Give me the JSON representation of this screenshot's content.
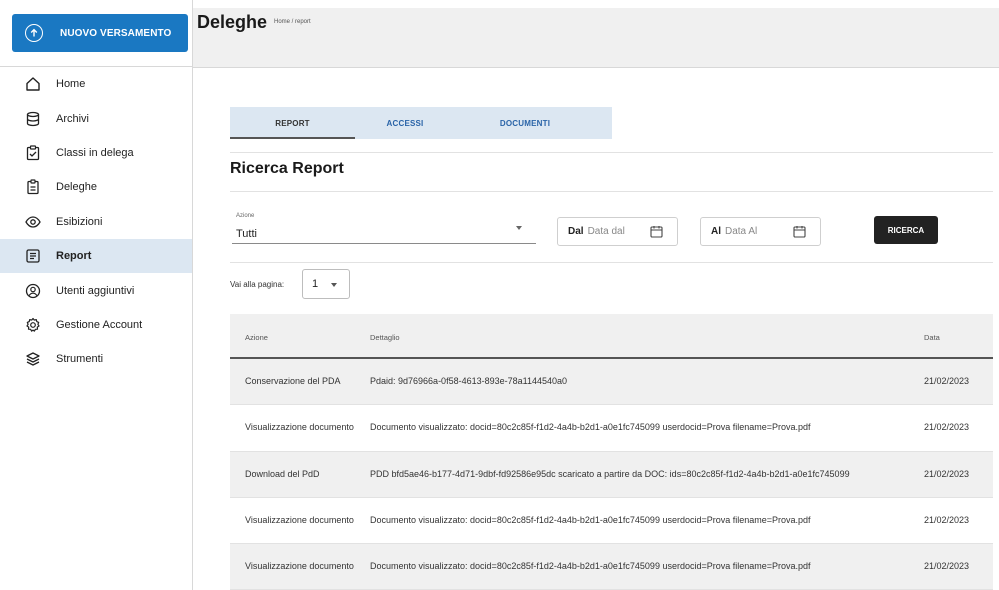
{
  "sidebar": {
    "new_button": "NUOVO VERSAMENTO",
    "items": [
      {
        "label": "Home",
        "icon": "home-icon"
      },
      {
        "label": "Archivi",
        "icon": "database-icon"
      },
      {
        "label": "Classi in delega",
        "icon": "clipboard-check-icon"
      },
      {
        "label": "Deleghe",
        "icon": "document-icon"
      },
      {
        "label": "Esibizioni",
        "icon": "eye-icon"
      },
      {
        "label": "Report",
        "icon": "report-icon",
        "active": true
      },
      {
        "label": "Utenti aggiuntivi",
        "icon": "user-icon"
      },
      {
        "label": "Gestione Account",
        "icon": "gear-icon"
      },
      {
        "label": "Strumenti",
        "icon": "layers-icon"
      }
    ]
  },
  "header": {
    "title": "Deleghe",
    "breadcrumb": "Home / report"
  },
  "tabs": [
    "REPORT",
    "ACCESSI",
    "DOCUMENTI"
  ],
  "section_title": "Ricerca Report",
  "filters": {
    "azione_label": "Azione",
    "azione_value": "Tutti",
    "dal_label": "Dal",
    "dal_placeholder": "Data dal",
    "al_label": "Al",
    "al_placeholder": "Data Al",
    "search_button": "RICERCA"
  },
  "pagination": {
    "label": "Vai alla pagina:",
    "value": "1"
  },
  "table": {
    "headers": [
      "Azione",
      "Dettaglio",
      "Data"
    ],
    "rows": [
      {
        "azione": "Conservazione del PDA",
        "dettaglio": "Pdaid: 9d76966a-0f58-4613-893e-78a1144540a0",
        "data": "21/02/2023"
      },
      {
        "azione": "Visualizzazione documento",
        "dettaglio": "Documento visualizzato: docid=80c2c85f-f1d2-4a4b-b2d1-a0e1fc745099 userdocid=Prova filename=Prova.pdf",
        "data": "21/02/2023"
      },
      {
        "azione": "Download del PdD",
        "dettaglio": "PDD bfd5ae46-b177-4d71-9dbf-fd92586e95dc scaricato a partire da DOC: ids=80c2c85f-f1d2-4a4b-b2d1-a0e1fc745099",
        "data": "21/02/2023"
      },
      {
        "azione": "Visualizzazione documento",
        "dettaglio": "Documento visualizzato: docid=80c2c85f-f1d2-4a4b-b2d1-a0e1fc745099 userdocid=Prova filename=Prova.pdf",
        "data": "21/02/2023"
      },
      {
        "azione": "Visualizzazione documento",
        "dettaglio": "Documento visualizzato: docid=80c2c85f-f1d2-4a4b-b2d1-a0e1fc745099 userdocid=Prova filename=Prova.pdf",
        "data": "21/02/2023"
      }
    ]
  }
}
